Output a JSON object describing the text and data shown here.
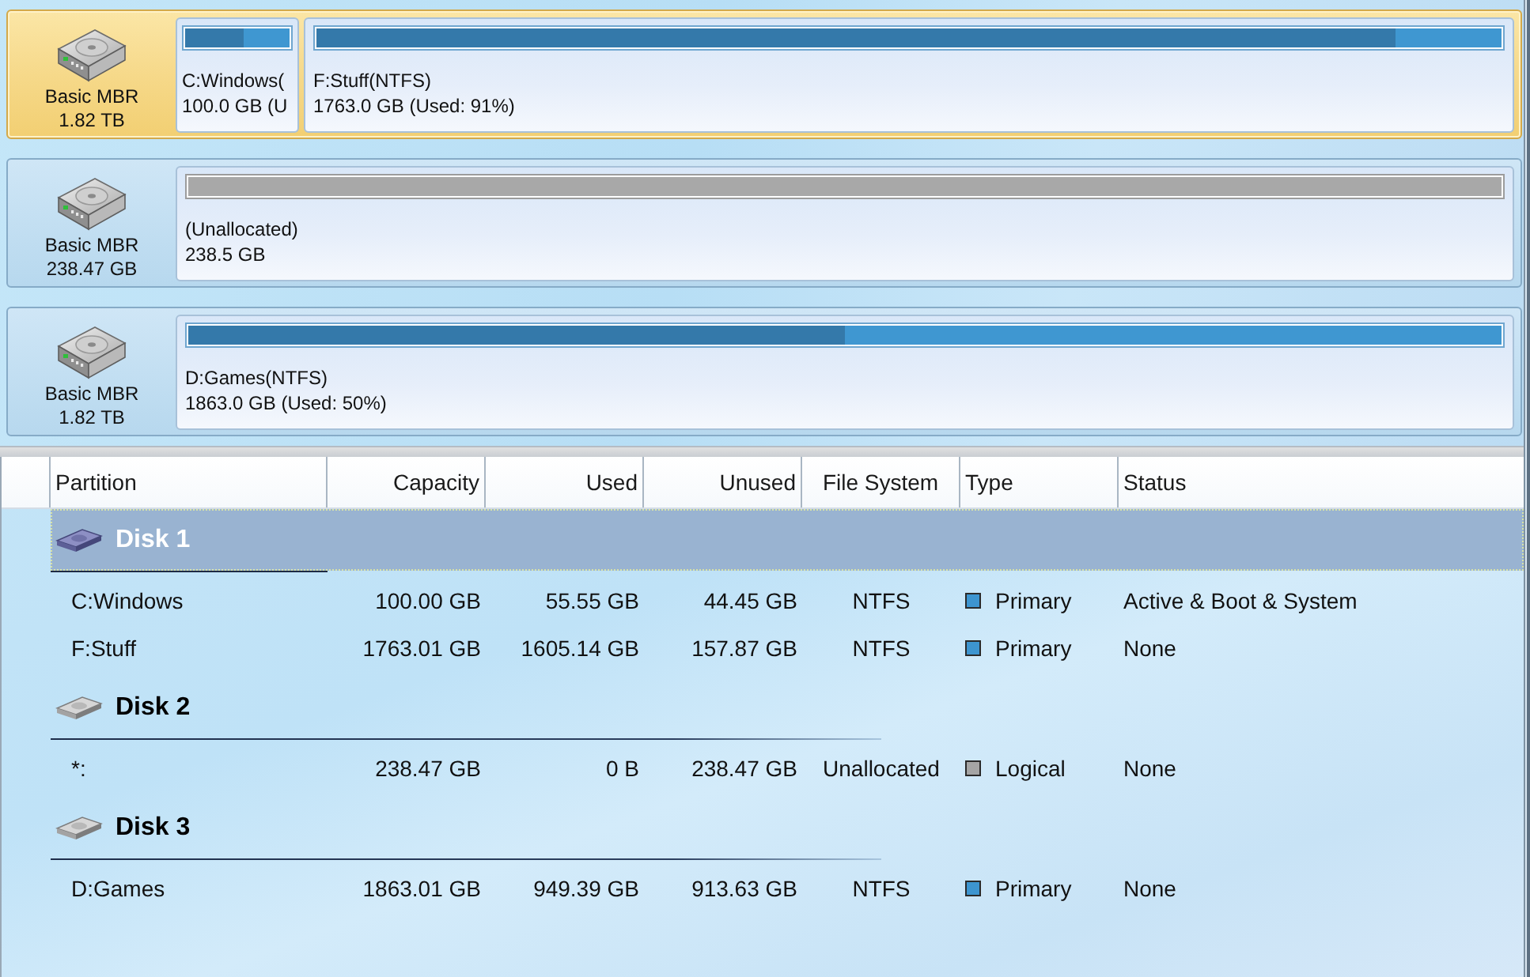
{
  "disk_map": [
    {
      "scheme": "Basic MBR",
      "size": "1.82 TB",
      "selected": true,
      "partitions": [
        {
          "kind": "used",
          "name": "C:Windows(",
          "detail": "100.0 GB (U",
          "level": 0.56
        },
        {
          "kind": "used",
          "name": "F:Stuff(NTFS)",
          "detail": "1763.0 GB (Used: 91%)",
          "level": 0.91
        }
      ]
    },
    {
      "scheme": "Basic MBR",
      "size": "238.47 GB",
      "selected": false,
      "partitions": [
        {
          "kind": "unallocated",
          "name": "(Unallocated)",
          "detail": "238.5 GB"
        }
      ]
    },
    {
      "scheme": "Basic MBR",
      "size": "1.82 TB",
      "selected": false,
      "partitions": [
        {
          "kind": "used",
          "name": "D:Games(NTFS)",
          "detail": "1863.0 GB (Used: 50%)",
          "level": 0.5
        }
      ]
    }
  ],
  "partition_table": {
    "columns": [
      "Partition",
      "Capacity",
      "Used",
      "Unused",
      "File System",
      "Type",
      "Status"
    ],
    "groups": [
      {
        "disk": "Disk 1",
        "selected": true,
        "rows": [
          {
            "partition": "C:Windows",
            "capacity": "100.00 GB",
            "used": "55.55 GB",
            "unused": "44.45 GB",
            "file_system": "NTFS",
            "type": "Primary",
            "color": "#3d95d0",
            "status": "Active & Boot & System"
          },
          {
            "partition": "F:Stuff",
            "capacity": "1763.01 GB",
            "used": "1605.14 GB",
            "unused": "157.87 GB",
            "file_system": "NTFS",
            "type": "Primary",
            "color": "#3d95d0",
            "status": "None"
          }
        ]
      },
      {
        "disk": "Disk 2",
        "selected": false,
        "rows": [
          {
            "partition": "*:",
            "capacity": "238.47 GB",
            "used": "0 B",
            "unused": "238.47 GB",
            "file_system": "Unallocated",
            "type": "Logical",
            "color": "#a5a5a5",
            "status": "None"
          }
        ]
      },
      {
        "disk": "Disk 3",
        "selected": false,
        "rows": [
          {
            "partition": "D:Games",
            "capacity": "1863.01 GB",
            "used": "949.39 GB",
            "unused": "913.63 GB",
            "file_system": "NTFS",
            "type": "Primary",
            "color": "#3d95d0",
            "status": "None"
          }
        ]
      }
    ]
  }
}
